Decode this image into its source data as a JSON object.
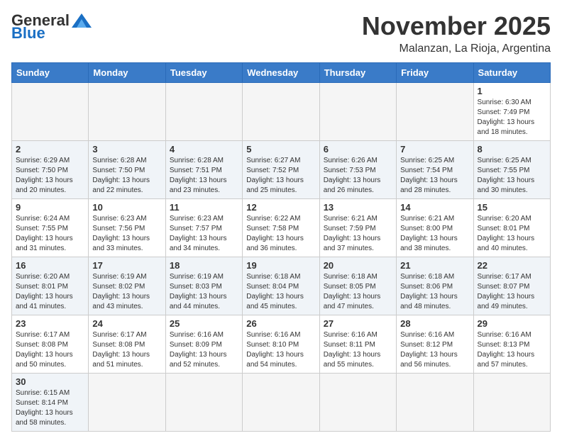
{
  "header": {
    "logo_general": "General",
    "logo_blue": "Blue",
    "month_title": "November 2025",
    "location": "Malanzan, La Rioja, Argentina"
  },
  "weekdays": [
    "Sunday",
    "Monday",
    "Tuesday",
    "Wednesday",
    "Thursday",
    "Friday",
    "Saturday"
  ],
  "weeks": [
    [
      {
        "day": "",
        "info": ""
      },
      {
        "day": "",
        "info": ""
      },
      {
        "day": "",
        "info": ""
      },
      {
        "day": "",
        "info": ""
      },
      {
        "day": "",
        "info": ""
      },
      {
        "day": "",
        "info": ""
      },
      {
        "day": "1",
        "info": "Sunrise: 6:30 AM\nSunset: 7:49 PM\nDaylight: 13 hours and 18 minutes."
      }
    ],
    [
      {
        "day": "2",
        "info": "Sunrise: 6:29 AM\nSunset: 7:50 PM\nDaylight: 13 hours and 20 minutes."
      },
      {
        "day": "3",
        "info": "Sunrise: 6:28 AM\nSunset: 7:50 PM\nDaylight: 13 hours and 22 minutes."
      },
      {
        "day": "4",
        "info": "Sunrise: 6:28 AM\nSunset: 7:51 PM\nDaylight: 13 hours and 23 minutes."
      },
      {
        "day": "5",
        "info": "Sunrise: 6:27 AM\nSunset: 7:52 PM\nDaylight: 13 hours and 25 minutes."
      },
      {
        "day": "6",
        "info": "Sunrise: 6:26 AM\nSunset: 7:53 PM\nDaylight: 13 hours and 26 minutes."
      },
      {
        "day": "7",
        "info": "Sunrise: 6:25 AM\nSunset: 7:54 PM\nDaylight: 13 hours and 28 minutes."
      },
      {
        "day": "8",
        "info": "Sunrise: 6:25 AM\nSunset: 7:55 PM\nDaylight: 13 hours and 30 minutes."
      }
    ],
    [
      {
        "day": "9",
        "info": "Sunrise: 6:24 AM\nSunset: 7:55 PM\nDaylight: 13 hours and 31 minutes."
      },
      {
        "day": "10",
        "info": "Sunrise: 6:23 AM\nSunset: 7:56 PM\nDaylight: 13 hours and 33 minutes."
      },
      {
        "day": "11",
        "info": "Sunrise: 6:23 AM\nSunset: 7:57 PM\nDaylight: 13 hours and 34 minutes."
      },
      {
        "day": "12",
        "info": "Sunrise: 6:22 AM\nSunset: 7:58 PM\nDaylight: 13 hours and 36 minutes."
      },
      {
        "day": "13",
        "info": "Sunrise: 6:21 AM\nSunset: 7:59 PM\nDaylight: 13 hours and 37 minutes."
      },
      {
        "day": "14",
        "info": "Sunrise: 6:21 AM\nSunset: 8:00 PM\nDaylight: 13 hours and 38 minutes."
      },
      {
        "day": "15",
        "info": "Sunrise: 6:20 AM\nSunset: 8:01 PM\nDaylight: 13 hours and 40 minutes."
      }
    ],
    [
      {
        "day": "16",
        "info": "Sunrise: 6:20 AM\nSunset: 8:01 PM\nDaylight: 13 hours and 41 minutes."
      },
      {
        "day": "17",
        "info": "Sunrise: 6:19 AM\nSunset: 8:02 PM\nDaylight: 13 hours and 43 minutes."
      },
      {
        "day": "18",
        "info": "Sunrise: 6:19 AM\nSunset: 8:03 PM\nDaylight: 13 hours and 44 minutes."
      },
      {
        "day": "19",
        "info": "Sunrise: 6:18 AM\nSunset: 8:04 PM\nDaylight: 13 hours and 45 minutes."
      },
      {
        "day": "20",
        "info": "Sunrise: 6:18 AM\nSunset: 8:05 PM\nDaylight: 13 hours and 47 minutes."
      },
      {
        "day": "21",
        "info": "Sunrise: 6:18 AM\nSunset: 8:06 PM\nDaylight: 13 hours and 48 minutes."
      },
      {
        "day": "22",
        "info": "Sunrise: 6:17 AM\nSunset: 8:07 PM\nDaylight: 13 hours and 49 minutes."
      }
    ],
    [
      {
        "day": "23",
        "info": "Sunrise: 6:17 AM\nSunset: 8:08 PM\nDaylight: 13 hours and 50 minutes."
      },
      {
        "day": "24",
        "info": "Sunrise: 6:17 AM\nSunset: 8:08 PM\nDaylight: 13 hours and 51 minutes."
      },
      {
        "day": "25",
        "info": "Sunrise: 6:16 AM\nSunset: 8:09 PM\nDaylight: 13 hours and 52 minutes."
      },
      {
        "day": "26",
        "info": "Sunrise: 6:16 AM\nSunset: 8:10 PM\nDaylight: 13 hours and 54 minutes."
      },
      {
        "day": "27",
        "info": "Sunrise: 6:16 AM\nSunset: 8:11 PM\nDaylight: 13 hours and 55 minutes."
      },
      {
        "day": "28",
        "info": "Sunrise: 6:16 AM\nSunset: 8:12 PM\nDaylight: 13 hours and 56 minutes."
      },
      {
        "day": "29",
        "info": "Sunrise: 6:16 AM\nSunset: 8:13 PM\nDaylight: 13 hours and 57 minutes."
      }
    ],
    [
      {
        "day": "30",
        "info": "Sunrise: 6:15 AM\nSunset: 8:14 PM\nDaylight: 13 hours and 58 minutes."
      },
      {
        "day": "",
        "info": ""
      },
      {
        "day": "",
        "info": ""
      },
      {
        "day": "",
        "info": ""
      },
      {
        "day": "",
        "info": ""
      },
      {
        "day": "",
        "info": ""
      },
      {
        "day": "",
        "info": ""
      }
    ]
  ]
}
